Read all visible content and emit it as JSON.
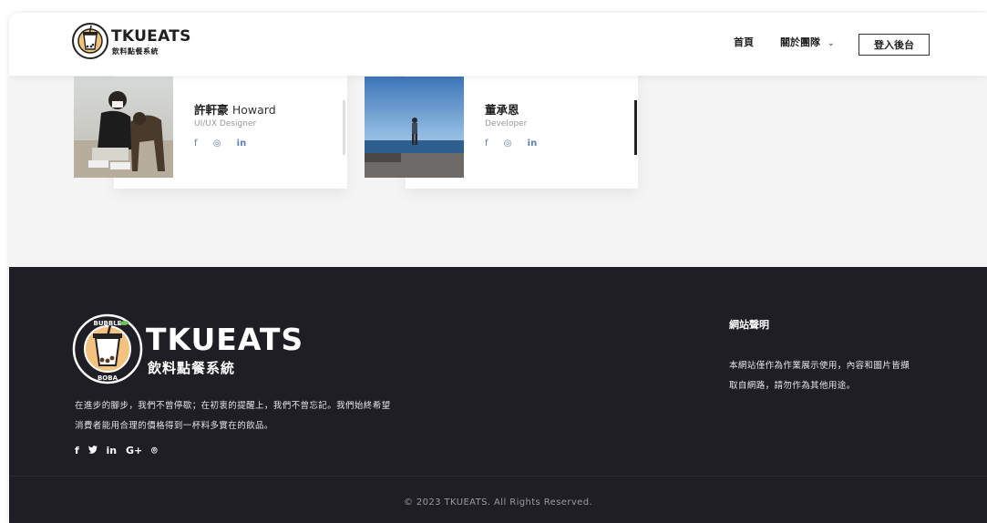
{
  "header": {
    "brand": "TKUEATS",
    "brand_sub": "飲料點餐系統",
    "badge_text": "BUBBLE BOBA",
    "nav_home": "首頁",
    "nav_about": "關於團隊",
    "nav_about_chevron": "⌄",
    "login_button": "登入後台"
  },
  "team": [
    {
      "name_zh": "許軒豪",
      "name_en": "Howard",
      "role": "UI/UX Designer",
      "social": [
        "f",
        "◎",
        "in"
      ]
    },
    {
      "name_zh": "董承恩",
      "name_en": "",
      "role": "Developer",
      "social": [
        "f",
        "◎",
        "in"
      ]
    }
  ],
  "footer": {
    "brand": "TKUEATS",
    "brand_sub": "飲料點餐系統",
    "badge_top": "BUBBLE",
    "badge_bottom": "BOBA",
    "slogan_line1": "在進步的腳步，我們不曾停歇；在初衷的提醒上，我們不曾忘記。我們始終希望",
    "slogan_line2": "消費者能用合理的價格得到一杯料多實在的飲品。",
    "social_icons": [
      "f",
      "🐦",
      "in",
      "G+",
      "⌾"
    ],
    "disclaimer_title": "網站聲明",
    "disclaimer_line1": "本網站僅作為作業展示使用，內容和圖片皆擷",
    "disclaimer_line2": "取自網路，請勿作為其他用途。",
    "copyright": "© 2023 TKUEATS. All Rights Reserved."
  },
  "colors": {
    "footer_bg": "#1e1e24",
    "social_blue": "#5a7fb0",
    "accent_bar": "#222222",
    "badge_orange": "#e8a24a"
  }
}
